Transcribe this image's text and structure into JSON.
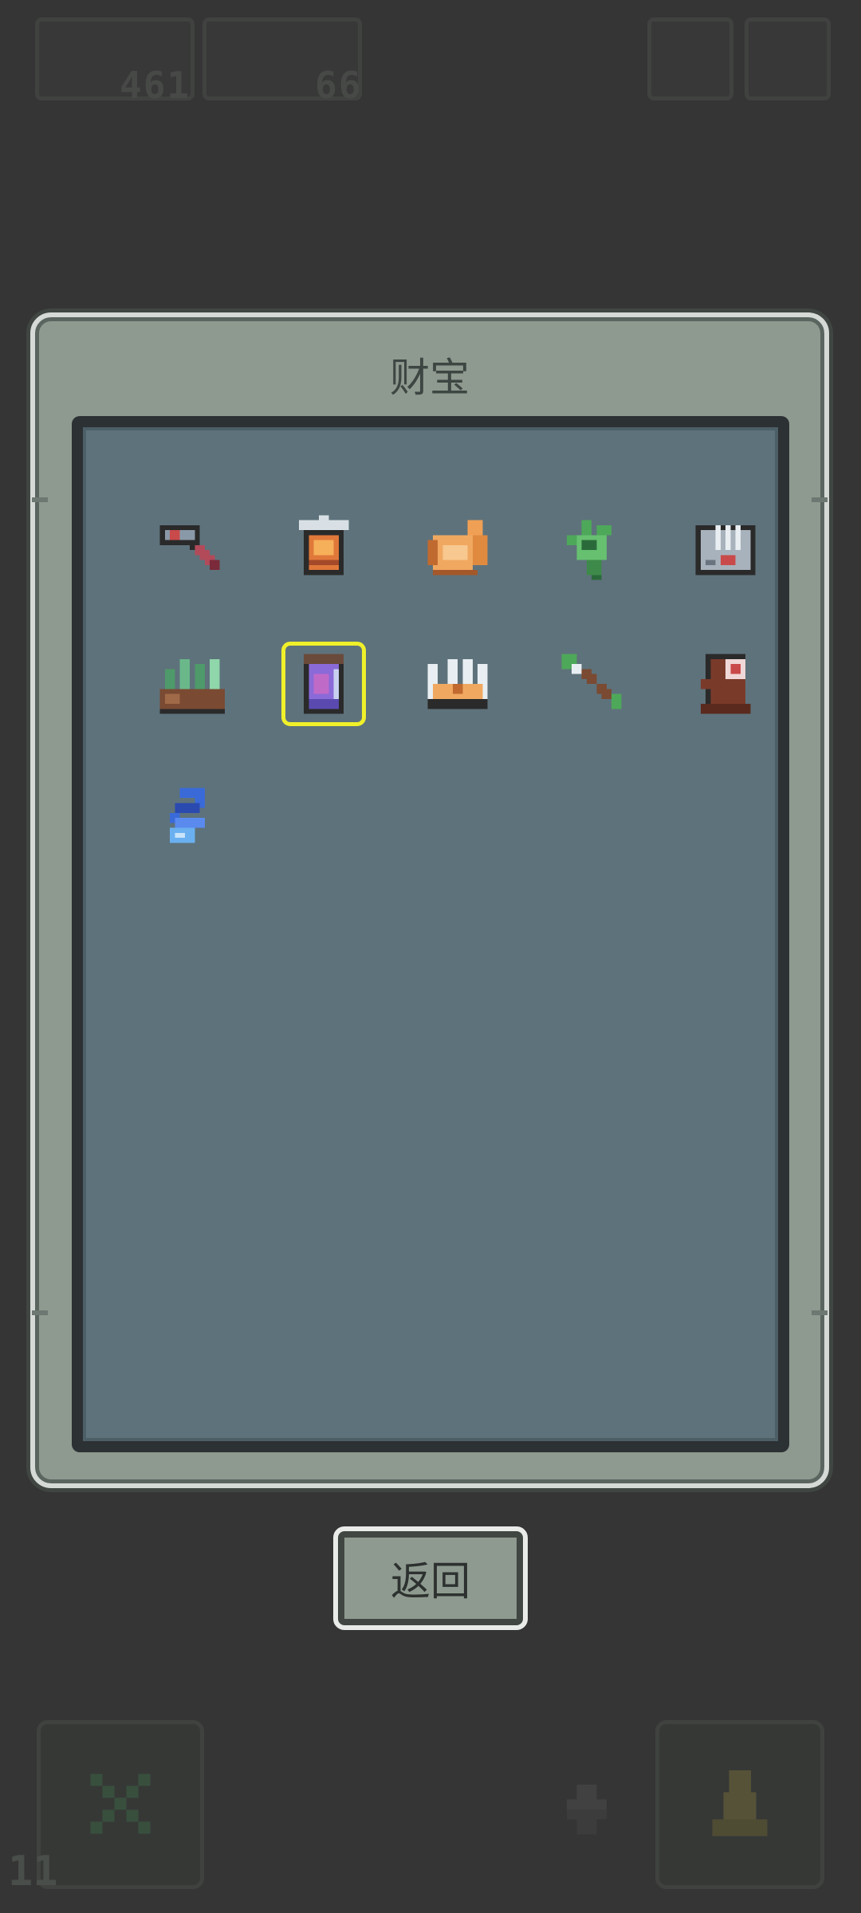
{
  "hud": {
    "currency_1": "461",
    "currency_2": "66",
    "level": "11"
  },
  "modal": {
    "title": "财宝"
  },
  "treasures": [
    {
      "icon": "hammer-icon"
    },
    {
      "icon": "lantern-icon"
    },
    {
      "icon": "horn-icon"
    },
    {
      "icon": "green-claw-icon"
    },
    {
      "icon": "stone-tablet-icon"
    },
    {
      "icon": "crystal-rock-icon"
    },
    {
      "icon": "potion-jar-icon",
      "selected": true
    },
    {
      "icon": "crown-icon"
    },
    {
      "icon": "spear-icon"
    },
    {
      "icon": "totem-icon"
    },
    {
      "icon": "blue-ribbon-icon"
    }
  ],
  "return_button": {
    "label": "返回"
  },
  "colors": {
    "background": "#353535",
    "panel": "#8e9a8f",
    "inner_panel": "#5e727b",
    "selection": "#f0f02a"
  }
}
